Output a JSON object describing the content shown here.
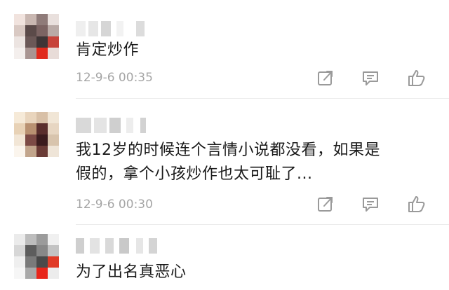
{
  "comments": [
    {
      "text": "肯定炒作",
      "time": "12-9-6 00:35"
    },
    {
      "text_line1": "我12岁的时候连个言情小说都没看，如果是",
      "text_line2": "假的，拿个小孩炒作也太可耻了...",
      "time": "12-9-6 00:30"
    },
    {
      "text": "为了出名真恶心"
    }
  ],
  "icons": [
    "share-icon",
    "reply-icon",
    "like-icon"
  ],
  "colors": {
    "text": "#1a1a1a",
    "meta": "#a5a5a5",
    "icon": "#9a9a9a",
    "divider": "#ececec"
  }
}
